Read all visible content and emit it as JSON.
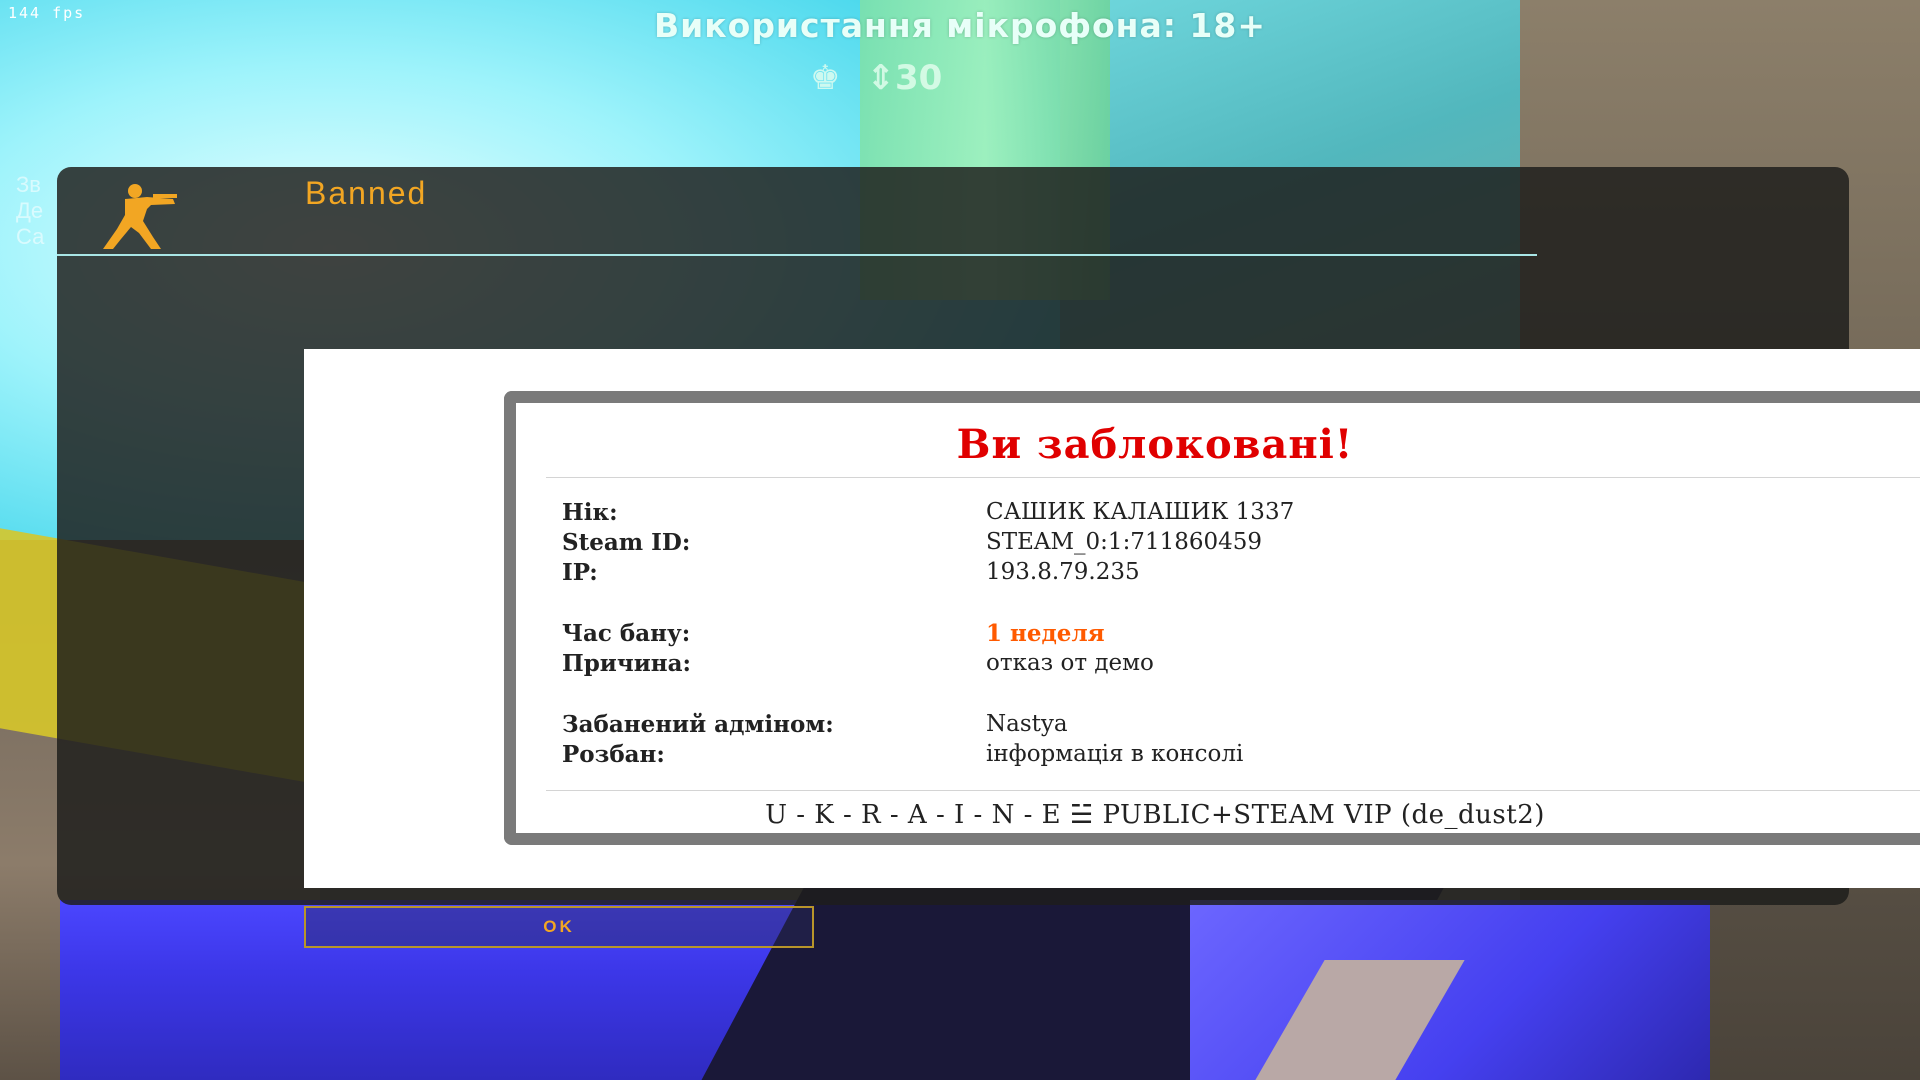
{
  "hud": {
    "fps": "144 fps",
    "mic_notice": "Використання мікрофона: 18+",
    "icons": [
      "crown-icon",
      "money-icon"
    ],
    "money_glyph": "⇕30",
    "left_chat_ghost": [
      "Зв",
      "Де",
      "Са"
    ]
  },
  "motd": {
    "title": "Banned",
    "logo_icon": "counter-terrorist-icon",
    "ok_label": "OK",
    "colors": {
      "title": "#f2a623",
      "window_bg": "#1e1e1c",
      "divider": "#a9e6e6"
    }
  },
  "ban": {
    "heading": "Ви заблоковані!",
    "rows": {
      "nick": {
        "label": "Нік:",
        "value": "САШИК КАЛАШИК 1337"
      },
      "steam_id": {
        "label": "Steam ID:",
        "value": "STEAM_0:1:711860459"
      },
      "ip": {
        "label": "IP:",
        "value": "193.8.79.235"
      },
      "ban_time": {
        "label": "Час бану:",
        "value": "1 неделя"
      },
      "reason": {
        "label": "Причина:",
        "value": "отказ от демо"
      },
      "admin": {
        "label": "Забанений адміном:",
        "value": "Nastya"
      },
      "unban": {
        "label": "Розбан:",
        "value": "інформація в консолі"
      }
    },
    "server": "U - K - R - A - I - N - E ☱ PUBLIC+STEAM VIP (de_dust2)",
    "colors": {
      "heading": "#e00000",
      "ban_time": "#ff5a00",
      "card_border": "#7a7a7a"
    }
  }
}
